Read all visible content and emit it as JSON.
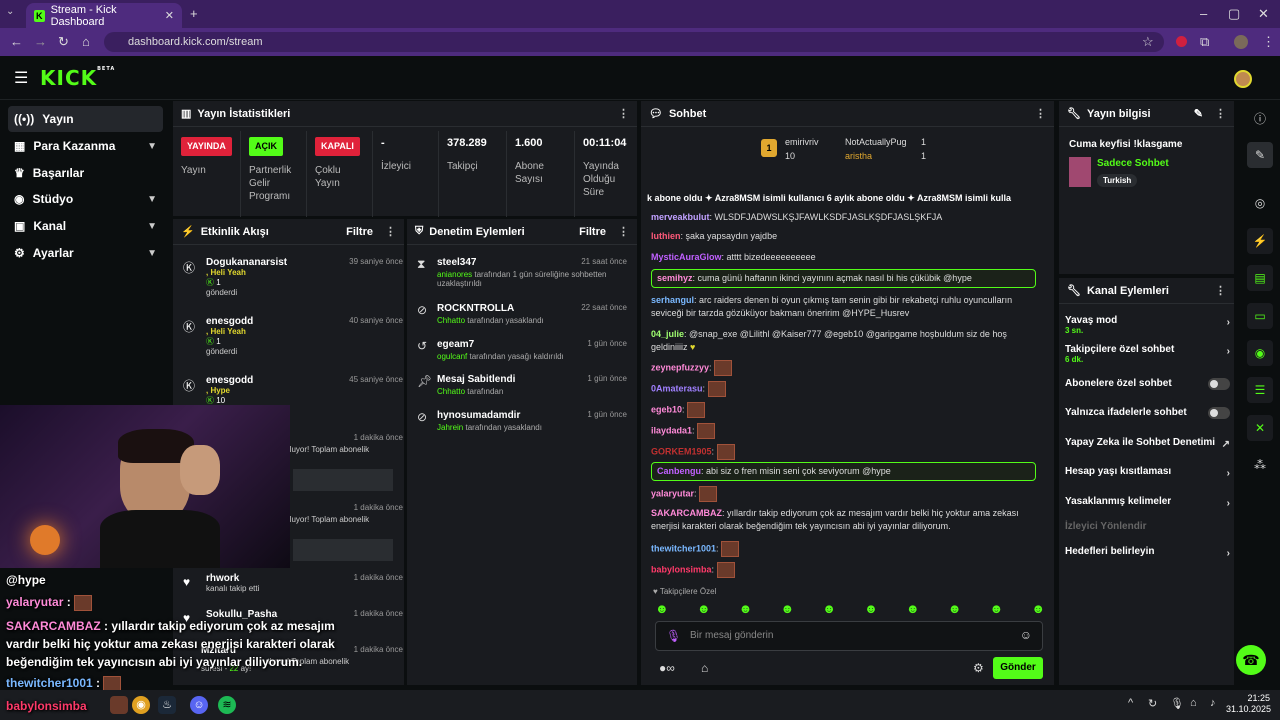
{
  "browser": {
    "tab_title": "Stream - Kick Dashboard",
    "url": "dashboard.kick.com/stream"
  },
  "kick": {
    "logo": "KICK",
    "logo_sup": "BETA"
  },
  "sidebar": {
    "items": [
      {
        "label": "Yayın"
      },
      {
        "label": "Para Kazanma"
      },
      {
        "label": "Başarılar"
      },
      {
        "label": "Stüdyo"
      },
      {
        "label": "Kanal"
      },
      {
        "label": "Ayarlar"
      }
    ]
  },
  "stats": {
    "title": "Yayın İstatistikleri",
    "live_badge": "YAYINDA",
    "live_label": "Yayın",
    "partner_badge": "AÇIK",
    "partner_label": "Partnerlik Gelir Programı",
    "multi_badge": "KAPALI",
    "multi_label": "Çoklu Yayın",
    "viewers_value": "-",
    "viewers_label": "İzleyici",
    "followers_value": "378.289",
    "followers_label": "Takipçi",
    "subs_value": "1.600",
    "subs_label": "Abone Sayısı",
    "uptime_value": "00:11:04",
    "uptime_label": "Yayında Olduğu Süre"
  },
  "activity": {
    "title": "Etkinlik Akışı",
    "filter": "Filtre",
    "events": [
      {
        "name": "Dogukananarsist",
        "detail": ", Heli Yeah",
        "count": "1",
        "sub": "gönderdi",
        "time": "39 saniye önce"
      },
      {
        "name": "enesgodd",
        "detail": ", Heli Yeah",
        "count": "1",
        "sub": "gönderdi",
        "time": "40 saniye önce"
      },
      {
        "name": "enesgodd",
        "detail": ", Hype",
        "count": "10",
        "sub": "",
        "time": "45 saniye önce"
      }
    ],
    "hidden": [
      {
        "text": "utluyor! Toplam abonelik",
        "time": "1 dakika önce"
      },
      {
        "text": "utluyor! Toplam abonelik",
        "time": "1 dakika önce"
      }
    ],
    "follow": [
      {
        "name": "rhwork",
        "sub": "kanalı takip etti",
        "time": "1 dakika önce"
      },
      {
        "name": "Sokullu_Pasha",
        "sub": "",
        "time": "1 dakika önce"
      },
      {
        "name": "Mzitaru",
        "sub": "utluyor! Toplam abonelik",
        "sub2": "süresi",
        "months": "22",
        "sub3": "ay!",
        "time": "1 dakika önce"
      }
    ]
  },
  "moderation": {
    "title": "Denetim Eylemleri",
    "filter": "Filtre",
    "actions": [
      {
        "name": "steel347",
        "by": "anianores",
        "text": "tarafından 1 gün süreliğine sohbetten uzaklaştırıldı",
        "time": "21 saat önce"
      },
      {
        "name": "ROCKNTROLLA",
        "by": "Chhatto",
        "text": "tarafından yasaklandı",
        "time": "22 saat önce"
      },
      {
        "name": "egeam7",
        "by": "ogulcanf",
        "text": "tarafından yasağı kaldırıldı",
        "time": "1 gün önce"
      },
      {
        "name": "Mesaj Sabitlendi",
        "by": "Chhatto",
        "text": "tarafından",
        "time": "1 gün önce"
      },
      {
        "name": "hynosumadamdir",
        "by": "Jahrein",
        "text": "tarafından yasaklandı",
        "time": "1 gün önce"
      }
    ]
  },
  "chat": {
    "title": "Sohbet",
    "leaders": [
      {
        "name": "emirivriv",
        "count": "10",
        "rank": "1"
      },
      {
        "name": "NotActuallyPug",
        "count": "1"
      },
      {
        "name": "aristha",
        "count": "1"
      }
    ],
    "ticker": "k abone oldu   ✦  Azra8MSM isimli kullanıcı 6 aylık abone oldu   ✦  Azra8MSM isimli kulla",
    "messages": [
      {
        "user": "merveakbulut",
        "text": "WLSDFJADWSLKŞJFAWLKSDFJASLKŞDFJASLŞKFJA",
        "color": "#c0a0ff"
      },
      {
        "user": "luthien",
        "text": "şaka yapsaydın yajdbe",
        "color": "#ff5a7a"
      },
      {
        "user": "MysticAuraGlow",
        "text": "atttt bizedeeeeeeeeee",
        "color": "#c060ff"
      },
      {
        "user": "semihyz",
        "text": "cuma günü haftanın ikinci yayınını açmak nasıl bi his çükübik @hype",
        "color": "#ff8ad8"
      },
      {
        "user": "serhangul",
        "text": "arc raiders denen bi oyun çıkmış tam senin gibi bir rekabetçi ruhlu oyunculların seviceği bir tarzda gözüküyor bakmanı öneririm @HYPE_Husrev",
        "color": "#7ab8ff"
      },
      {
        "user": "04_julie",
        "text": "@snap_exe @Lilithl @Kaiser777 @egeb10 @garipgame hoşbuldum siz de hoş geldiniiiiz",
        "color": "#a0ff70"
      },
      {
        "user": "zeynepfuzzyy",
        "text": "",
        "color": "#ff8ad8"
      },
      {
        "user": "0Amaterasu",
        "text": "",
        "color": "#a080ff"
      },
      {
        "user": "egeb10",
        "text": "",
        "color": "#ff8ad8"
      },
      {
        "user": "ilaydada1",
        "text": "",
        "color": "#ff8ad8"
      },
      {
        "user": "GORKEM1905",
        "text": "",
        "color": "#c03030"
      },
      {
        "user": "Canbengu",
        "text": "abi siz o fren misin seni çok seviyorum @hype",
        "color": "#c060ff"
      },
      {
        "user": "yalaryutar",
        "text": "",
        "color": "#ff8ad8"
      },
      {
        "user": "SAKARCAMBAZ",
        "text": "yıllardır takip ediyorum çok az mesajım vardır belki hiç yoktur ama zekası enerjisi karakteri olarak beğendiğim tek yayıncısın abi iyi yayınlar diliyorum.",
        "color": "#ff8ad8"
      },
      {
        "user": "thewitcher1001",
        "text": "",
        "color": "#7ab8ff"
      },
      {
        "user": "babylonsimba",
        "text": "",
        "color": "#ff3a6a"
      }
    ],
    "followers_only": "Takipçilere Özel",
    "placeholder": "Bir mesaj gönderin",
    "send": "Gönder"
  },
  "stream_info": {
    "title": "Yayın bilgisi",
    "stream_title": "Cuma keyfisi !klasgame",
    "category": "Sadece Sohbet",
    "tag": "Turkish"
  },
  "channel_actions": {
    "title": "Kanal Eylemleri",
    "items": [
      {
        "label": "Yavaş mod",
        "sub": "3 sn."
      },
      {
        "label": "Takipçilere özel sohbet",
        "sub": "6 dk."
      },
      {
        "label": "Abonelere özel sohbet"
      },
      {
        "label": "Yalnızca ifadelerle sohbet"
      },
      {
        "label": "Yapay Zeka ile Sohbet Denetimi"
      },
      {
        "label": "Hesap yaşı kısıtlaması"
      },
      {
        "label": "Yasaklanmış kelimeler"
      },
      {
        "label": "İzleyici Yönlendir"
      },
      {
        "label": "Hedefleri belirleyin"
      }
    ]
  },
  "overlay": {
    "lines": [
      {
        "user": "",
        "text": "@hype"
      },
      {
        "user": "yalaryutar",
        "text": ""
      },
      {
        "user": "SAKARCAMBAZ",
        "text": "yıllardır takip ediyorum çok az mesajım"
      },
      {
        "user": "",
        "text": "vardır belki hiç yoktur ama zekası enerjisi karakteri olarak"
      },
      {
        "user": "",
        "text": "beğendiğim tek yayıncısın abi iyi yayınlar diliyorum."
      },
      {
        "user": "thewitcher1001",
        "text": ""
      },
      {
        "user": "babylonsimba",
        "text": ""
      }
    ]
  },
  "taskbar": {
    "time": "21:25",
    "date": "31.10.2025"
  },
  "colors": {
    "accent": "#53fc18",
    "live": "#e0223a",
    "panel": "#191b1f"
  }
}
